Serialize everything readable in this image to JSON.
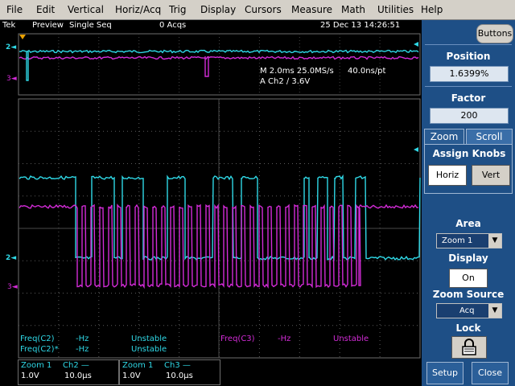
{
  "menu": [
    "File",
    "Edit",
    "Vertical",
    "Horiz/Acq",
    "Trig",
    "Display",
    "Cursors",
    "Measure",
    "Math",
    "Utilities",
    "Help"
  ],
  "status": {
    "brand": "Tek",
    "mode": "Preview",
    "acq_mode": "Single Seq",
    "acqs": "0 Acqs",
    "datetime": "25 Dec 13 14:26:51"
  },
  "overview_readout": {
    "timebase": "M 2.0ms 25.0MS/s",
    "resolution": "40.0ns/pt",
    "trigger": "A  Ch2  ∕  3.6V"
  },
  "buttons_label": "Buttons",
  "panel": {
    "position_label": "Position",
    "position_value": "1.6399%",
    "factor_label": "Factor",
    "factor_value": "200",
    "tab_zoom": "Zoom",
    "tab_scroll": "Scroll",
    "assign_knobs_label": "Assign Knobs",
    "horiz_label": "Horiz",
    "vert_label": "Vert",
    "area_label": "Area",
    "area_value": "Zoom 1",
    "display_label": "Display",
    "display_value": "On",
    "zoom_source_label": "Zoom Source",
    "zoom_source_value": "Acq",
    "lock_label": "Lock",
    "setup_label": "Setup",
    "close_label": "Close"
  },
  "measurements": [
    {
      "name": "Freq(C2)",
      "value": "-Hz",
      "status": "Unstable"
    },
    {
      "name": "Freq(C2)*",
      "value": "-Hz",
      "status": "Unstable"
    },
    {
      "name": "Freq(C3)",
      "value": "-Hz",
      "status": "Unstable"
    }
  ],
  "readouts": [
    {
      "zoom": "Zoom 1",
      "channel": "Ch2 —",
      "volts": "1.0V",
      "time": "10.0µs"
    },
    {
      "zoom": "Zoom 1",
      "channel": "Ch3 —",
      "volts": "1.0V",
      "time": "10.0µs"
    }
  ],
  "channel_markers": {
    "ch2_marker": "2◄",
    "ch3_marker": "3◄"
  },
  "colors": {
    "ch2": "#2fd8e6",
    "ch3": "#d22bd6",
    "menubar": "#d4d0c8",
    "panel": "#1e4f86"
  },
  "icons": [
    "lock-icon",
    "trigger-arrow-icon",
    "dropdown-arrow-icon"
  ]
}
